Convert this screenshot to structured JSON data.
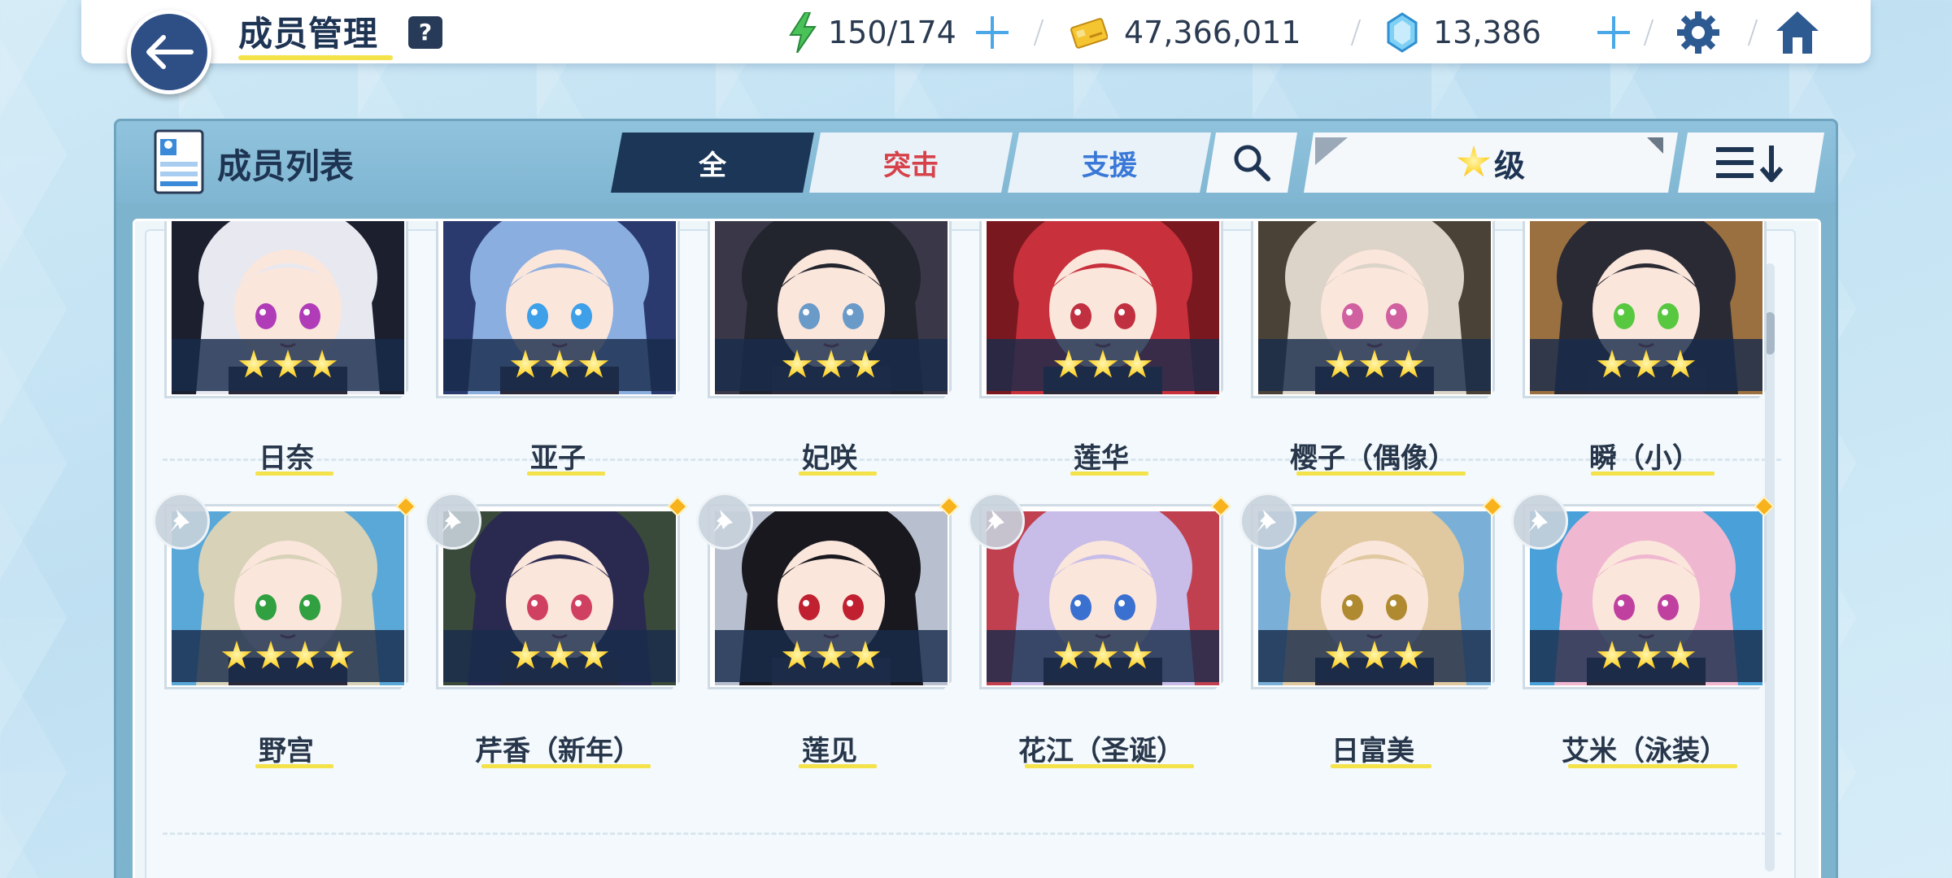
{
  "header": {
    "title": "成员管理",
    "help_label": "?",
    "ap": "150/174",
    "credits": "47,366,011",
    "gems": "13,386"
  },
  "panel": {
    "title": "成员列表",
    "tabs": [
      {
        "label": "全"
      },
      {
        "label": "突击"
      },
      {
        "label": "支援"
      }
    ],
    "filter_label": "级",
    "filter_icon": "star-icon"
  },
  "colors": {
    "accent_dark": "#1b3656",
    "strike_red": "#d6414a",
    "support_blue": "#3a78d8",
    "star_gold": "#ffd83a",
    "underline_yellow": "#f4e24a"
  },
  "students": [
    {
      "name": "日奈",
      "stars": 3,
      "pinned": false
    },
    {
      "name": "亚子",
      "stars": 3,
      "pinned": false
    },
    {
      "name": "妃咲",
      "stars": 3,
      "pinned": false
    },
    {
      "name": "莲华",
      "stars": 3,
      "pinned": false
    },
    {
      "name": "樱子（偶像）",
      "stars": 3,
      "pinned": false
    },
    {
      "name": "瞬（小）",
      "stars": 3,
      "pinned": false
    },
    {
      "name": "野宫",
      "stars": 4,
      "pinned": true
    },
    {
      "name": "芹香（新年）",
      "stars": 3,
      "pinned": true
    },
    {
      "name": "莲见",
      "stars": 3,
      "pinned": true
    },
    {
      "name": "花江（圣诞）",
      "stars": 3,
      "pinned": true
    },
    {
      "name": "日富美",
      "stars": 3,
      "pinned": true
    },
    {
      "name": "艾米（泳装）",
      "stars": 3,
      "pinned": true
    }
  ]
}
